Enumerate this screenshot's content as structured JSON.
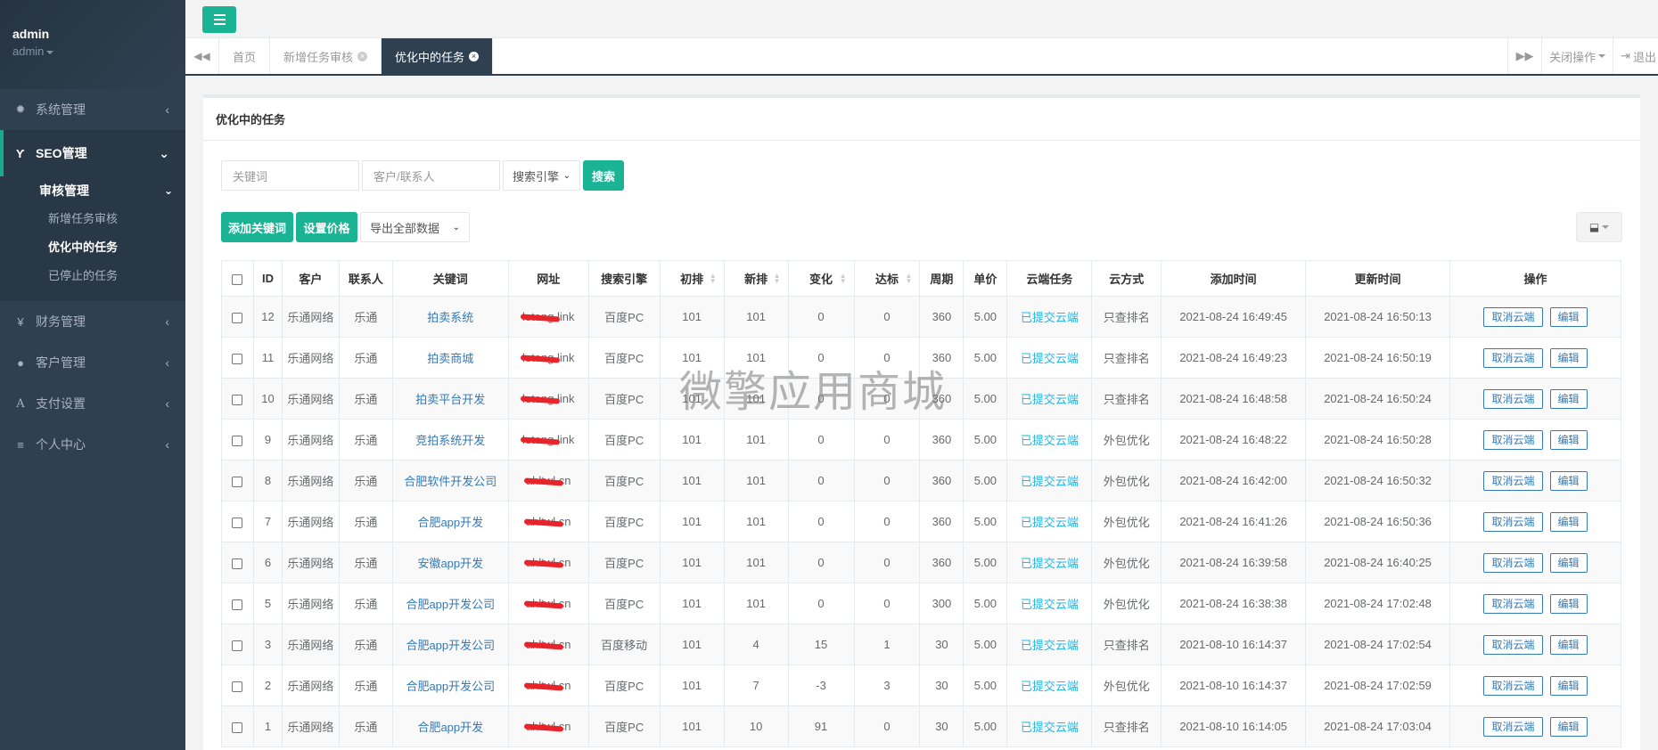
{
  "sidebar": {
    "username": "admin",
    "role": "admin",
    "items": [
      {
        "label": "系统管理",
        "icon": "gear-icon"
      },
      {
        "label": "SEO管理",
        "icon": "filter-icon"
      },
      {
        "label": "财务管理",
        "icon": "yen-icon"
      },
      {
        "label": "客户管理",
        "icon": "user-icon"
      },
      {
        "label": "支付设置",
        "icon": "font-icon"
      },
      {
        "label": "个人中心",
        "icon": "list-icon"
      }
    ],
    "sub": {
      "label": "审核管理",
      "children": [
        "新增任务审核",
        "优化中的任务",
        "已停止的任务"
      ]
    }
  },
  "tabs": {
    "items": [
      "首页",
      "新增任务审核",
      "优化中的任务"
    ],
    "close_ops": "关闭操作",
    "logout": "退出"
  },
  "panel": {
    "title": "优化中的任务",
    "keyword_placeholder": "关键词",
    "customer_placeholder": "客户/联系人",
    "engine_select": "搜索引擎",
    "search_btn": "搜索",
    "add_keyword_btn": "添加关键词",
    "set_price_btn": "设置价格",
    "export_select": "导出全部数据"
  },
  "table": {
    "headers": [
      "ID",
      "客户",
      "联系人",
      "关键词",
      "网址",
      "搜索引擎",
      "初排",
      "新排",
      "变化",
      "达标",
      "周期",
      "单价",
      "云端任务",
      "云方式",
      "添加时间",
      "更新时间",
      "操作"
    ],
    "cancel_label": "取消云端",
    "edit_label": "编辑",
    "rows": [
      {
        "id": "12",
        "customer": "乐通网络",
        "contact": "乐通",
        "keyword": "拍卖系统",
        "url": "letong.link",
        "engine": "百度PC",
        "init": "101",
        "new": "101",
        "change": "0",
        "reach": "0",
        "cycle": "360",
        "price": "5.00",
        "cloud": "已提交云端",
        "mode": "只查排名",
        "added": "2021-08-24 16:49:45",
        "updated": "2021-08-24 16:50:13"
      },
      {
        "id": "11",
        "customer": "乐通网络",
        "contact": "乐通",
        "keyword": "拍卖商城",
        "url": "letong.link",
        "engine": "百度PC",
        "init": "101",
        "new": "101",
        "change": "0",
        "reach": "0",
        "cycle": "360",
        "price": "5.00",
        "cloud": "已提交云端",
        "mode": "只查排名",
        "added": "2021-08-24 16:49:23",
        "updated": "2021-08-24 16:50:19"
      },
      {
        "id": "10",
        "customer": "乐通网络",
        "contact": "乐通",
        "keyword": "拍卖平台开发",
        "url": "letong.link",
        "engine": "百度PC",
        "init": "101",
        "new": "101",
        "change": "0",
        "reach": "0",
        "cycle": "360",
        "price": "5.00",
        "cloud": "已提交云端",
        "mode": "只查排名",
        "added": "2021-08-24 16:48:58",
        "updated": "2021-08-24 16:50:24"
      },
      {
        "id": "9",
        "customer": "乐通网络",
        "contact": "乐通",
        "keyword": "竞拍系统开发",
        "url": "letong.link",
        "engine": "百度PC",
        "init": "101",
        "new": "101",
        "change": "0",
        "reach": "0",
        "cycle": "360",
        "price": "5.00",
        "cloud": "已提交云端",
        "mode": "外包优化",
        "added": "2021-08-24 16:48:22",
        "updated": "2021-08-24 16:50:28"
      },
      {
        "id": "8",
        "customer": "乐通网络",
        "contact": "乐通",
        "keyword": "合肥软件开发公司",
        "url": "ahltwl.cn",
        "engine": "百度PC",
        "init": "101",
        "new": "101",
        "change": "0",
        "reach": "0",
        "cycle": "360",
        "price": "5.00",
        "cloud": "已提交云端",
        "mode": "外包优化",
        "added": "2021-08-24 16:42:00",
        "updated": "2021-08-24 16:50:32"
      },
      {
        "id": "7",
        "customer": "乐通网络",
        "contact": "乐通",
        "keyword": "合肥app开发",
        "url": "ahltwl.cn",
        "engine": "百度PC",
        "init": "101",
        "new": "101",
        "change": "0",
        "reach": "0",
        "cycle": "360",
        "price": "5.00",
        "cloud": "已提交云端",
        "mode": "外包优化",
        "added": "2021-08-24 16:41:26",
        "updated": "2021-08-24 16:50:36"
      },
      {
        "id": "6",
        "customer": "乐通网络",
        "contact": "乐通",
        "keyword": "安徽app开发",
        "url": "ahltwl.cn",
        "engine": "百度PC",
        "init": "101",
        "new": "101",
        "change": "0",
        "reach": "0",
        "cycle": "360",
        "price": "5.00",
        "cloud": "已提交云端",
        "mode": "外包优化",
        "added": "2021-08-24 16:39:58",
        "updated": "2021-08-24 16:40:25"
      },
      {
        "id": "5",
        "customer": "乐通网络",
        "contact": "乐通",
        "keyword": "合肥app开发公司",
        "url": "ahltwl.cn",
        "engine": "百度PC",
        "init": "101",
        "new": "101",
        "change": "0",
        "reach": "0",
        "cycle": "300",
        "price": "5.00",
        "cloud": "已提交云端",
        "mode": "外包优化",
        "added": "2021-08-24 16:38:38",
        "updated": "2021-08-24 17:02:48"
      },
      {
        "id": "3",
        "customer": "乐通网络",
        "contact": "乐通",
        "keyword": "合肥app开发公司",
        "url": "ahltwl.cn",
        "engine": "百度移动",
        "init": "101",
        "new": "4",
        "change": "15",
        "reach": "1",
        "cycle": "30",
        "price": "5.00",
        "cloud": "已提交云端",
        "mode": "只查排名",
        "added": "2021-08-10 16:14:37",
        "updated": "2021-08-24 17:02:54"
      },
      {
        "id": "2",
        "customer": "乐通网络",
        "contact": "乐通",
        "keyword": "合肥app开发公司",
        "url": "ahltwl.cn",
        "engine": "百度PC",
        "init": "101",
        "new": "7",
        "change": "-3",
        "reach": "3",
        "cycle": "30",
        "price": "5.00",
        "cloud": "已提交云端",
        "mode": "外包优化",
        "added": "2021-08-10 16:14:37",
        "updated": "2021-08-24 17:02:59"
      },
      {
        "id": "1",
        "customer": "乐通网络",
        "contact": "乐通",
        "keyword": "合肥app开发",
        "url": "ahltwl.cn",
        "engine": "百度PC",
        "init": "101",
        "new": "10",
        "change": "91",
        "reach": "0",
        "cycle": "30",
        "price": "5.00",
        "cloud": "已提交云端",
        "mode": "只查排名",
        "added": "2021-08-10 16:14:05",
        "updated": "2021-08-24 17:03:04"
      }
    ]
  },
  "watermark": "微擎应用商城",
  "colors": {
    "primary": "#1ab394",
    "sidebar": "#2f4050",
    "link": "#337ab7",
    "cloud": "#23b7e5"
  }
}
